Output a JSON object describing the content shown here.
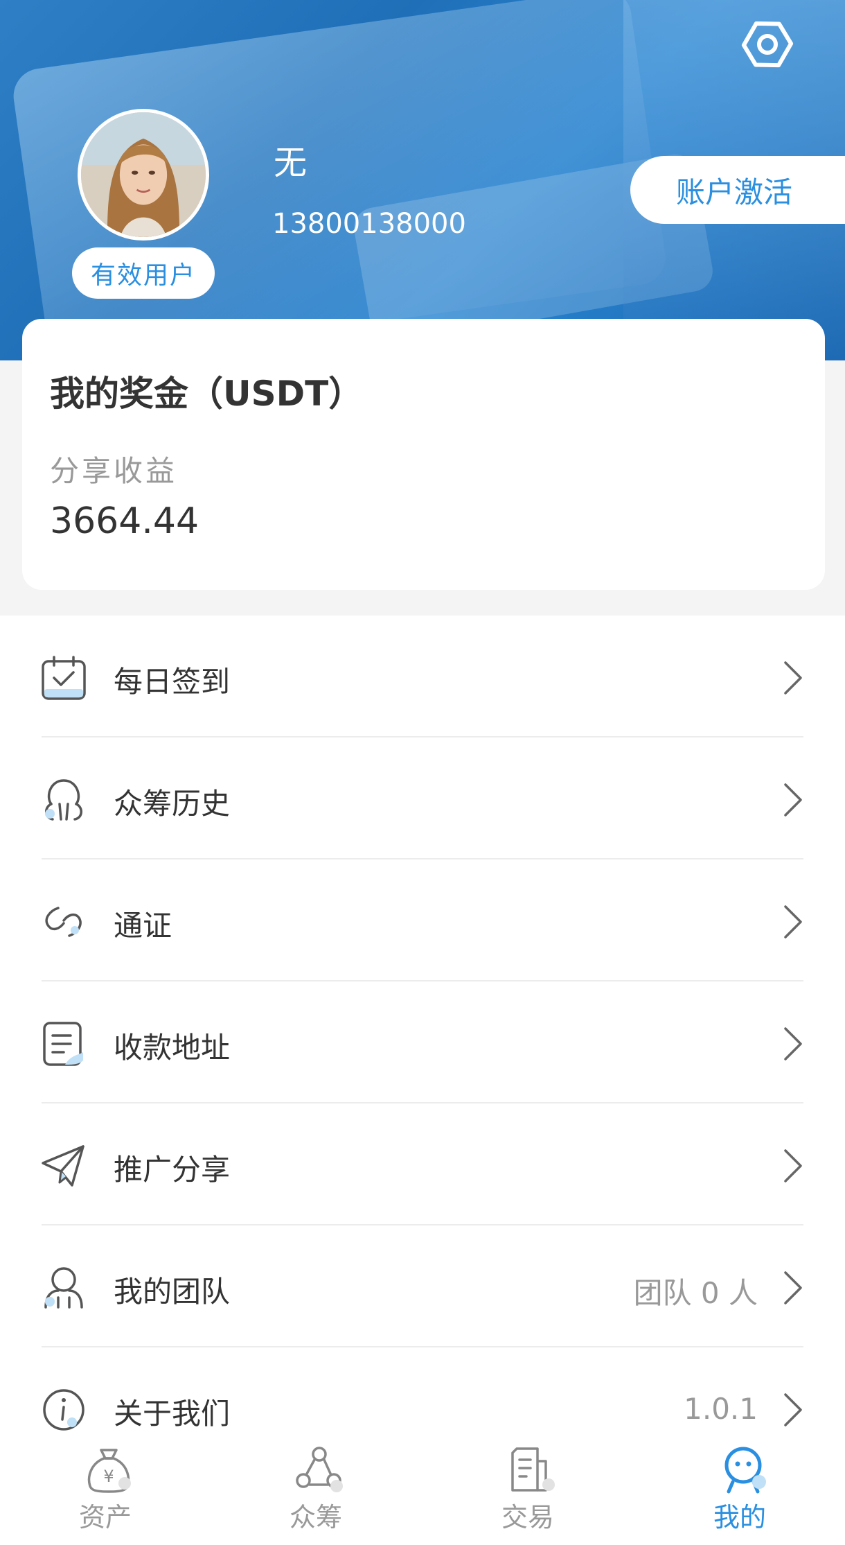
{
  "header": {
    "nickname": "无",
    "phone": "13800138000",
    "user_badge": "有效用户",
    "activate_button": "账户激活"
  },
  "bonus_card": {
    "title": "我的奖金（USDT）",
    "subtitle": "分享收益",
    "value": "3664.44"
  },
  "menu": {
    "items": [
      {
        "label": "每日签到",
        "icon": "calendar-check-icon",
        "extra": ""
      },
      {
        "label": "众筹历史",
        "icon": "crowdfund-history-icon",
        "extra": ""
      },
      {
        "label": "通证",
        "icon": "link-icon",
        "extra": ""
      },
      {
        "label": "收款地址",
        "icon": "document-icon",
        "extra": ""
      },
      {
        "label": "推广分享",
        "icon": "paper-plane-icon",
        "extra": ""
      },
      {
        "label": "我的团队",
        "icon": "team-icon",
        "extra": "团队 0 人"
      },
      {
        "label": "关于我们",
        "icon": "info-icon",
        "extra": "1.0.1"
      }
    ]
  },
  "tabbar": {
    "tabs": [
      {
        "label": "资产",
        "icon": "money-bag-icon"
      },
      {
        "label": "众筹",
        "icon": "crowdfund-icon"
      },
      {
        "label": "交易",
        "icon": "trade-icon"
      },
      {
        "label": "我的",
        "icon": "profile-icon"
      }
    ],
    "active_index": 3
  },
  "colors": {
    "accent": "#2a8fe0",
    "hero": "#1f6fb8",
    "text": "#333333",
    "muted": "#999999"
  }
}
